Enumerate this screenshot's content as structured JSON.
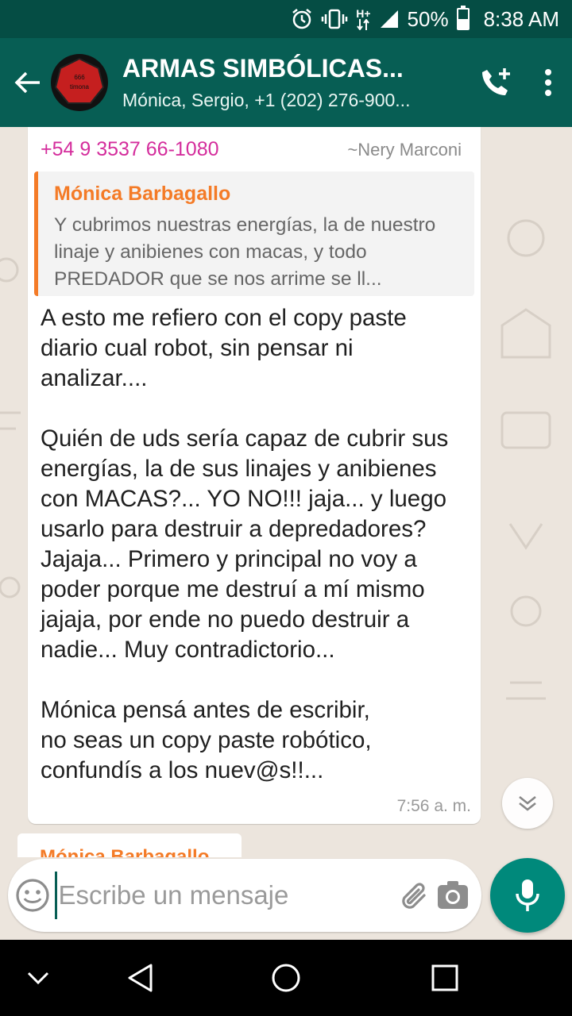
{
  "status_bar": {
    "network_type": "H+",
    "battery_percent": "50%",
    "battery_level": 0.5,
    "time": "8:38 AM",
    "icons": [
      "alarm-icon",
      "vibrate-icon",
      "data-arrows-icon",
      "signal-icon",
      "battery-icon"
    ]
  },
  "header": {
    "title": "ARMAS SIMBÓLICAS...",
    "subtitle": "Mónica, Sergio, +1 (202) 276-900...",
    "avatar_text_top": "666",
    "avatar_text_bottom": "timona",
    "colors": {
      "bar": "#075e54",
      "status": "#054d44",
      "avatar_red": "#c51f1f"
    }
  },
  "message": {
    "sender_phone": "+54 9 3537 66-1080",
    "sender_name": "~Nery Marconi",
    "quote_author": "Mónica Barbagallo",
    "quote_text": "Y cubrimos nuestras energías, la de nuestro linaje y anibienes con macas, y todo PREDADOR que se nos arrime se ll...",
    "paragraphs": [
      "A esto me refiero con el copy paste diario cual robot, sin pensar ni analizar....",
      "Quién de uds sería capaz de cubrir sus energías, la de sus linajes y anibienes con MACAS?... YO NO!!! jaja... y luego usarlo para destruir a depredadores? Jajaja... Primero y principal no voy a poder porque me destruí a mí mismo jajaja, por ende no puedo destruir a nadie... Muy contradictorio...",
      "Mónica pensá antes de escribir,\nno seas un copy paste robótico, confundís a los nuev@s!!..."
    ],
    "time": "7:56 a. m.",
    "colors": {
      "phone": "#d42d9c",
      "quote_author": "#f47b27"
    }
  },
  "next_message": {
    "sender_partial": "Mónica Barbagallo"
  },
  "composer": {
    "placeholder": "Escribe un mensaje",
    "value": ""
  },
  "accent": {
    "mic_button": "#00897b"
  }
}
